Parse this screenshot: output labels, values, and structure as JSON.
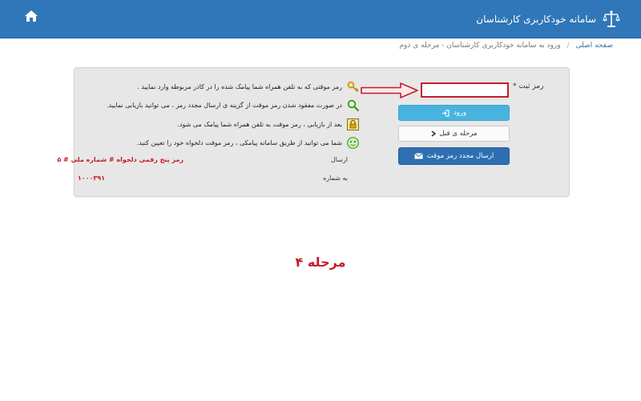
{
  "header": {
    "title": "سامانه خودکاربری کارشناسان",
    "logo_icon": "scales-of-justice-icon",
    "home_icon": "home-icon",
    "background_color": "#2f77b8"
  },
  "breadcrumb": {
    "home": "صفحه اصلی",
    "current": "ورود به سامانه خودکاربری کارشناسان - مرحله ی دوم"
  },
  "form": {
    "password_label": "رمز ثبت *",
    "password_value": "",
    "login_button": "ورود",
    "prev_button": "مرحله ی قبل",
    "resend_button": "ارسال مجدد رمز موقت"
  },
  "info": {
    "line1": "رمز موقتی که به تلفن همراه شما پیامک شده را در کادر مربوطه وارد نمایید .",
    "line2": "در صورت مفقود شدن رمز موقت از گزینه ی ارسال مجدد رمز ، می توانید بازیابی نمایید.",
    "line3": "بعد از بازیابی ، رمز موقت به تلفن همراه شما پیامک می شود.",
    "line4": "شما می توانید از طریق سامانه پیامکی ، رمز موقت دلخواه خود را تعیین کنید.",
    "send_label": "ارسال",
    "send_value": "رمز پنج رقمی دلخواه # شماره ملی # ۵",
    "to_number_label": "به شماره",
    "to_number_value": "۱۰۰۰۳۹۱"
  },
  "step_title": "مرحله ۴",
  "colors": {
    "accent_red": "#c51d27",
    "login_button": "#49b3df",
    "resend_button": "#2e6fb2"
  }
}
